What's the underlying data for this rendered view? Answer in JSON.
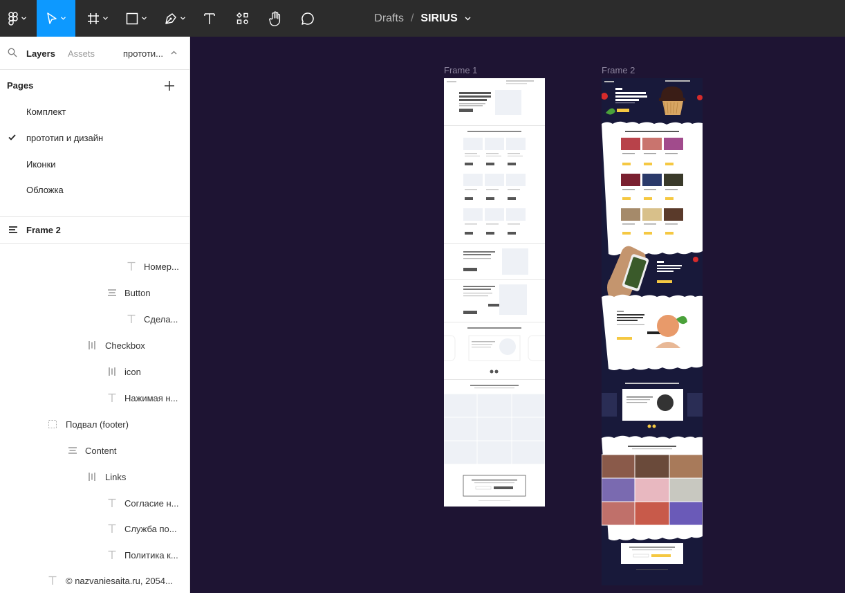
{
  "toolbar": {
    "tools": [
      "main-menu",
      "move",
      "frame",
      "shape",
      "pen",
      "text",
      "resources",
      "hand",
      "comment"
    ]
  },
  "title": {
    "crumb": "Drafts",
    "separator": "/",
    "file": "SIRIUS"
  },
  "sidebar": {
    "tabs": {
      "layers": "Layers",
      "assets": "Assets",
      "page_switch": "прототи..."
    },
    "pages_header": "Pages",
    "pages": [
      {
        "label": "Комплект",
        "current": false
      },
      {
        "label": "прототип и дизайн",
        "current": true
      },
      {
        "label": "Иконки",
        "current": false
      },
      {
        "label": "Обложка",
        "current": false
      }
    ],
    "current_frame": "Frame 2",
    "layers": [
      {
        "label": "Номер...",
        "icon": "text-icon"
      },
      {
        "label": "Button",
        "icon": "autolayout-vertical-icon"
      },
      {
        "label": "Сдела...",
        "icon": "text-icon"
      },
      {
        "label": "Checkbox",
        "icon": "autolayout-horizontal-icon"
      },
      {
        "label": "icon",
        "icon": "autolayout-horizontal-icon"
      },
      {
        "label": "Нажимая н...",
        "icon": "text-icon"
      },
      {
        "label": "Подвал (footer)",
        "icon": "frame-dashed-icon"
      },
      {
        "label": "Content",
        "icon": "autolayout-vertical-icon"
      },
      {
        "label": "Links",
        "icon": "autolayout-horizontal-icon"
      },
      {
        "label": "Согласие н...",
        "icon": "text-icon"
      },
      {
        "label": "Служба по...",
        "icon": "text-icon"
      },
      {
        "label": "Политика к...",
        "icon": "text-icon"
      },
      {
        "label": "© nazvaniesaita.ru, 2054...",
        "icon": "text-icon"
      }
    ]
  },
  "canvas": {
    "background": "#1e1433",
    "frames": [
      {
        "label": "Frame 1"
      },
      {
        "label": "Frame 2"
      }
    ]
  },
  "colors": {
    "accent": "#0d99ff",
    "toolbar": "#2c2c2c",
    "frame2_bg": "#18193a",
    "cta_yellow": "#f5c842"
  }
}
